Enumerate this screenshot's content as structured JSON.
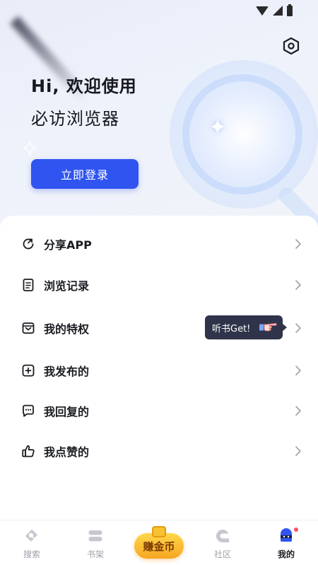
{
  "header": {
    "greeting": "Hi, 欢迎使用",
    "app_name": "必访浏览器",
    "login_label": "立即登录"
  },
  "menu": {
    "items": [
      {
        "label": "分享APP",
        "icon": "share-icon"
      },
      {
        "label": "浏览记录",
        "icon": "history-icon"
      },
      {
        "label": "我的特权",
        "icon": "privilege-icon"
      },
      {
        "label": "我发布的",
        "icon": "publish-icon"
      },
      {
        "label": "我回复的",
        "icon": "reply-icon"
      },
      {
        "label": "我点赞的",
        "icon": "like-icon"
      }
    ],
    "tooltip": "听书Get!"
  },
  "bottom_nav": {
    "items": [
      {
        "label": "搜索",
        "icon": "search-tag-icon"
      },
      {
        "label": "书架",
        "icon": "bookshelf-icon"
      },
      {
        "label": "社区",
        "icon": "community-icon"
      },
      {
        "label": "我的",
        "icon": "profile-icon"
      }
    ],
    "earn_label": "赚金币",
    "active": "我的"
  },
  "colors": {
    "accent": "#2f54f0",
    "earn": "#f7a521",
    "tooltip_bg": "#30344a"
  }
}
